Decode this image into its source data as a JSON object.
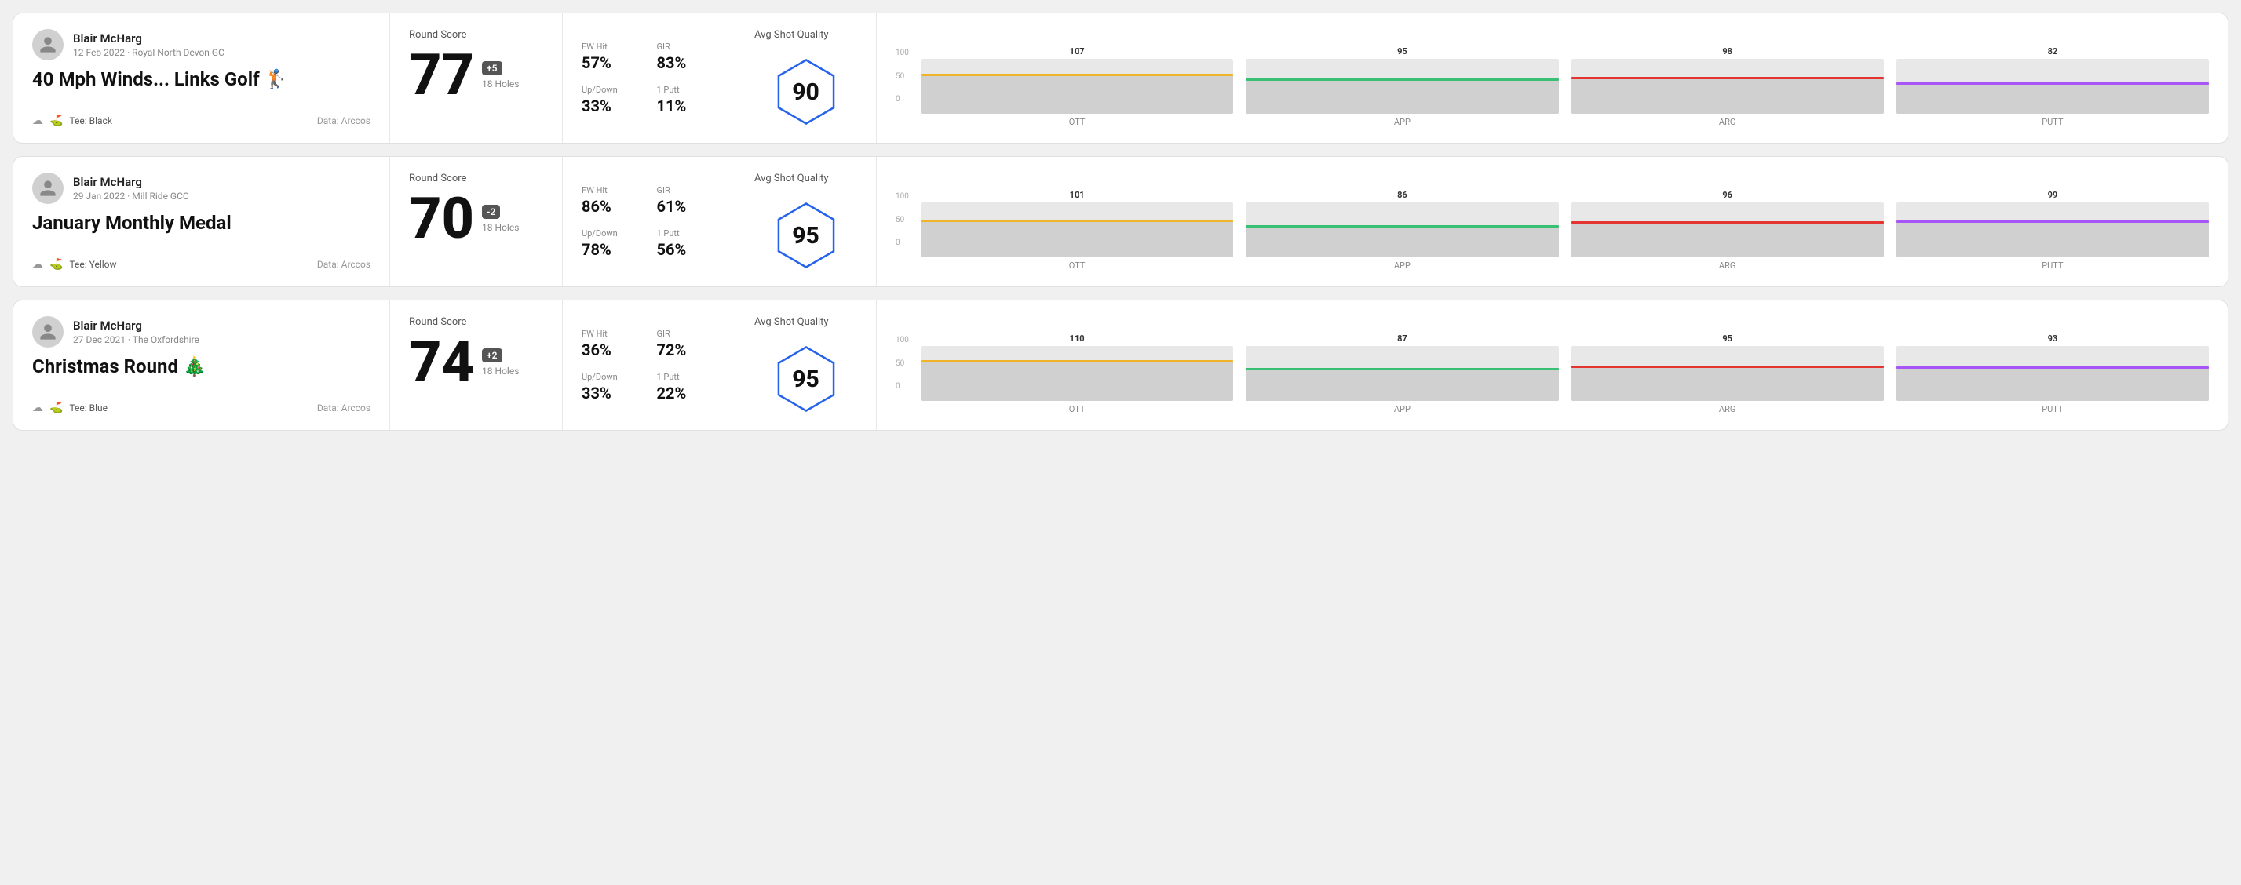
{
  "rounds": [
    {
      "id": "round-1",
      "user": {
        "name": "Blair McHarg",
        "date": "12 Feb 2022",
        "club": "Royal North Devon GC"
      },
      "title": "40 Mph Winds... Links Golf",
      "title_emoji": "🏌️",
      "tee": "Black",
      "data_source": "Data: Arccos",
      "score": {
        "number": "77",
        "diff": "+5",
        "diff_type": "positive",
        "holes": "18 Holes"
      },
      "stats": {
        "fw_hit_label": "FW Hit",
        "fw_hit_value": "57%",
        "gir_label": "GIR",
        "gir_value": "83%",
        "updown_label": "Up/Down",
        "updown_value": "33%",
        "oneputt_label": "1 Putt",
        "oneputt_value": "11%"
      },
      "shot_quality": {
        "label": "Avg Shot Quality",
        "score": "90"
      },
      "chart": {
        "bars": [
          {
            "label": "OTT",
            "value": 107,
            "color": "#f0b429",
            "fill_pct": 71
          },
          {
            "label": "APP",
            "value": 95,
            "color": "#38c172",
            "fill_pct": 63
          },
          {
            "label": "ARG",
            "value": 98,
            "color": "#e3342f",
            "fill_pct": 65
          },
          {
            "label": "PUTT",
            "value": 82,
            "color": "#a855f7",
            "fill_pct": 55
          }
        ]
      }
    },
    {
      "id": "round-2",
      "user": {
        "name": "Blair McHarg",
        "date": "29 Jan 2022",
        "club": "Mill Ride GCC"
      },
      "title": "January Monthly Medal",
      "title_emoji": "",
      "tee": "Yellow",
      "data_source": "Data: Arccos",
      "score": {
        "number": "70",
        "diff": "-2",
        "diff_type": "negative",
        "holes": "18 Holes"
      },
      "stats": {
        "fw_hit_label": "FW Hit",
        "fw_hit_value": "86%",
        "gir_label": "GIR",
        "gir_value": "61%",
        "updown_label": "Up/Down",
        "updown_value": "78%",
        "oneputt_label": "1 Putt",
        "oneputt_value": "56%"
      },
      "shot_quality": {
        "label": "Avg Shot Quality",
        "score": "95"
      },
      "chart": {
        "bars": [
          {
            "label": "OTT",
            "value": 101,
            "color": "#f0b429",
            "fill_pct": 67
          },
          {
            "label": "APP",
            "value": 86,
            "color": "#38c172",
            "fill_pct": 57
          },
          {
            "label": "ARG",
            "value": 96,
            "color": "#e3342f",
            "fill_pct": 64
          },
          {
            "label": "PUTT",
            "value": 99,
            "color": "#a855f7",
            "fill_pct": 66
          }
        ]
      }
    },
    {
      "id": "round-3",
      "user": {
        "name": "Blair McHarg",
        "date": "27 Dec 2021",
        "club": "The Oxfordshire"
      },
      "title": "Christmas Round",
      "title_emoji": "🎄",
      "tee": "Blue",
      "data_source": "Data: Arccos",
      "score": {
        "number": "74",
        "diff": "+2",
        "diff_type": "positive",
        "holes": "18 Holes"
      },
      "stats": {
        "fw_hit_label": "FW Hit",
        "fw_hit_value": "36%",
        "gir_label": "GIR",
        "gir_value": "72%",
        "updown_label": "Up/Down",
        "updown_value": "33%",
        "oneputt_label": "1 Putt",
        "oneputt_value": "22%"
      },
      "shot_quality": {
        "label": "Avg Shot Quality",
        "score": "95"
      },
      "chart": {
        "bars": [
          {
            "label": "OTT",
            "value": 110,
            "color": "#f0b429",
            "fill_pct": 73
          },
          {
            "label": "APP",
            "value": 87,
            "color": "#38c172",
            "fill_pct": 58
          },
          {
            "label": "ARG",
            "value": 95,
            "color": "#e3342f",
            "fill_pct": 63
          },
          {
            "label": "PUTT",
            "value": 93,
            "color": "#a855f7",
            "fill_pct": 62
          }
        ]
      }
    }
  ],
  "labels": {
    "round_score": "Round Score",
    "avg_shot_quality": "Avg Shot Quality",
    "y_axis": [
      "100",
      "50",
      "0"
    ],
    "data_arccos": "Data: Arccos",
    "tee_prefix": "Tee:"
  }
}
